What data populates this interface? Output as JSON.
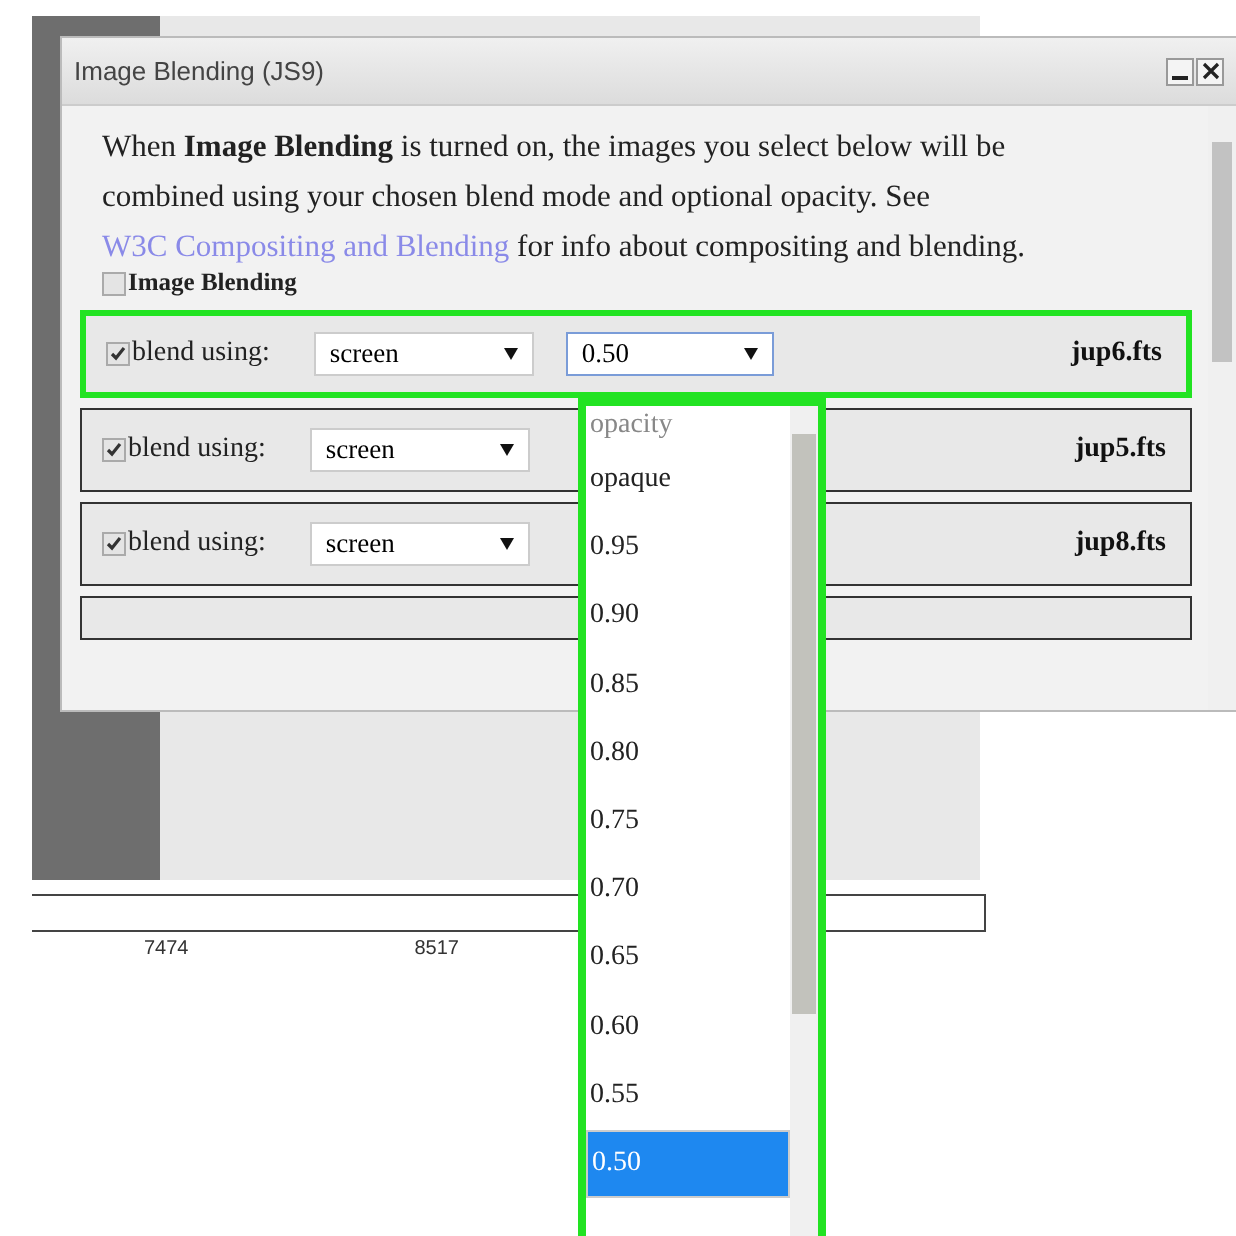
{
  "window": {
    "title": "Image Blending (JS9)"
  },
  "intro": {
    "text": "When **Image Blending** is turned on, the images you select below will be combined using your chosen blend mode and optional opacity. See ",
    "link": "W3C Compositing and Blending",
    "tail": " for info about compositing and blending."
  },
  "master": {
    "label": "Image Blending",
    "checked": false
  },
  "rows": [
    {
      "checked": true,
      "label": "blend using:",
      "mode": "screen",
      "opacity": "0.50",
      "file": "jup6.fts",
      "highlighted": true
    },
    {
      "checked": true,
      "label": "blend using:",
      "mode": "screen",
      "file": "jup5.fts",
      "highlighted": false
    },
    {
      "checked": true,
      "label": "blend using:",
      "mode": "screen",
      "file": "jup8.fts",
      "highlighted": false
    }
  ],
  "opacity_menu": {
    "highlighted": true,
    "items": [
      {
        "label": "opacity",
        "disabled": true,
        "selected": false
      },
      {
        "label": "opaque",
        "disabled": false,
        "selected": false
      },
      {
        "label": "0.95",
        "disabled": false,
        "selected": false
      },
      {
        "label": "0.90",
        "disabled": false,
        "selected": false
      },
      {
        "label": "0.85",
        "disabled": false,
        "selected": false
      },
      {
        "label": "0.80",
        "disabled": false,
        "selected": false
      },
      {
        "label": "0.75",
        "disabled": false,
        "selected": false
      },
      {
        "label": "0.70",
        "disabled": false,
        "selected": false
      },
      {
        "label": "0.65",
        "disabled": false,
        "selected": false
      },
      {
        "label": "0.60",
        "disabled": false,
        "selected": false
      },
      {
        "label": "0.55",
        "disabled": false,
        "selected": false
      },
      {
        "label": "0.50",
        "disabled": false,
        "selected": true
      }
    ]
  },
  "axis": {
    "ticks": [
      "7474",
      "8517"
    ]
  }
}
